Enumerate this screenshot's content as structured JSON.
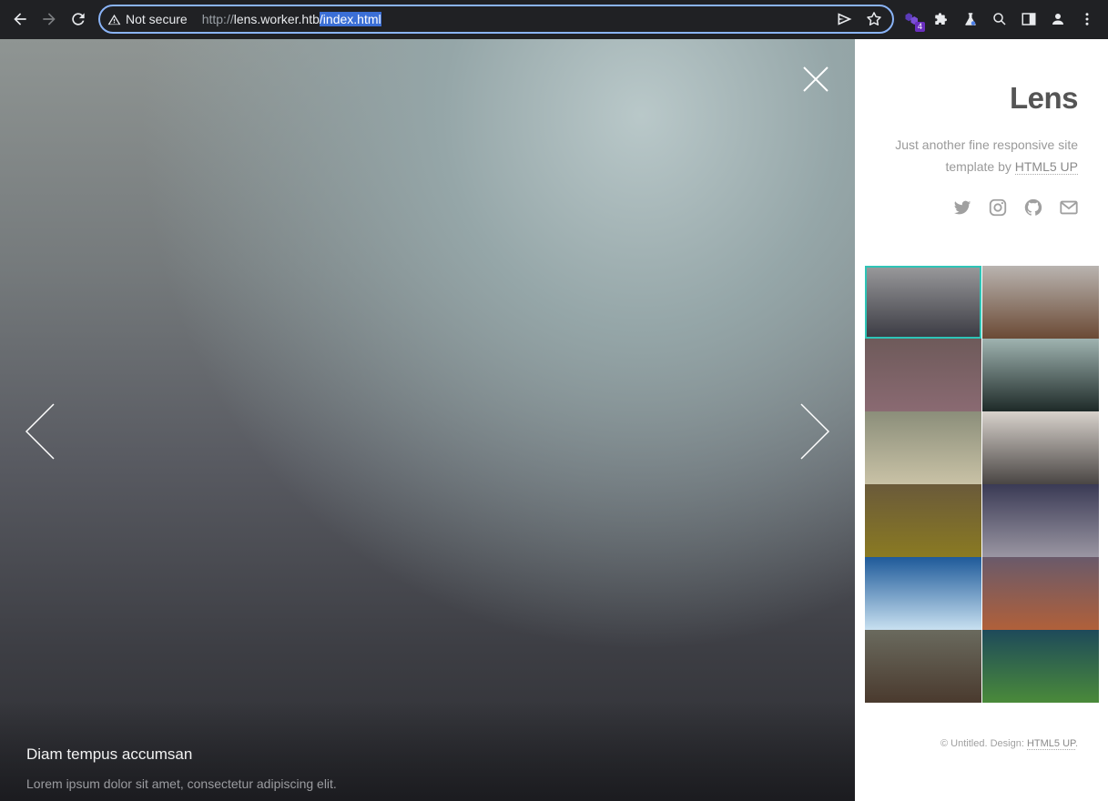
{
  "browser": {
    "security_label": "Not secure",
    "url_scheme": "http://",
    "url_host": "lens.worker.htb",
    "url_path": "/index.html",
    "extension_badge": "4"
  },
  "viewer": {
    "caption_title": "Diam tempus accumsan",
    "caption_text": "Lorem ipsum dolor sit amet, consectetur adipiscing elit."
  },
  "sidebar": {
    "title": "Lens",
    "tagline_prefix": "Just another fine responsive site template by ",
    "tagline_link": "HTML5 UP",
    "social": [
      "twitter-icon",
      "instagram-icon",
      "github-icon",
      "email-icon"
    ],
    "thumbs": [
      {
        "colors": [
          "#9a9a9c",
          "#3a3a42"
        ],
        "active": true
      },
      {
        "colors": [
          "#b9b4b0",
          "#6b4a35"
        ],
        "active": false
      },
      {
        "colors": [
          "#6e5a5a",
          "#8a6a72"
        ],
        "active": false
      },
      {
        "colors": [
          "#9fb3b0",
          "#1e2a28"
        ],
        "active": false
      },
      {
        "colors": [
          "#8b8e7a",
          "#c9c2a6"
        ],
        "active": false
      },
      {
        "colors": [
          "#d8d2cc",
          "#4a4644"
        ],
        "active": false
      },
      {
        "colors": [
          "#6a5a3a",
          "#8a7a22"
        ],
        "active": false
      },
      {
        "colors": [
          "#3a3a55",
          "#9a96a2"
        ],
        "active": false
      },
      {
        "colors": [
          "#1e5a9a",
          "#c8e0f0"
        ],
        "active": false
      },
      {
        "colors": [
          "#6a5a6a",
          "#b0603a"
        ],
        "active": false
      },
      {
        "colors": [
          "#6a6a5e",
          "#4a3a2e"
        ],
        "active": false
      },
      {
        "colors": [
          "#1e4a5a",
          "#4a8a3a"
        ],
        "active": false
      }
    ],
    "footer_prefix": "© Untitled.  Design: ",
    "footer_link": "HTML5 UP",
    "footer_suffix": "."
  },
  "colors": {
    "active_thumb_border": "#2ec4b6",
    "chrome_bg": "#202124",
    "omnibox_border": "#8ab4f8"
  }
}
